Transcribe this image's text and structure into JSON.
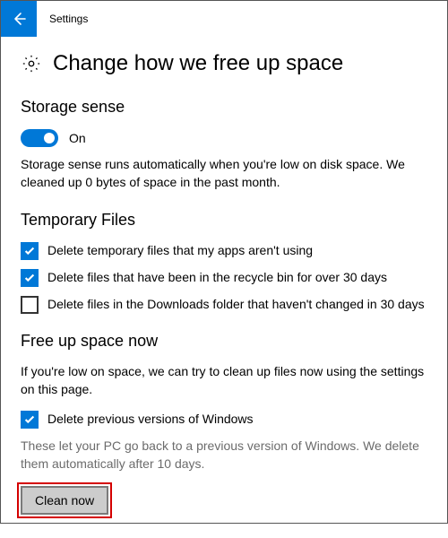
{
  "titlebar": {
    "app_name": "Settings"
  },
  "page": {
    "title": "Change how we free up space"
  },
  "storage_sense": {
    "heading": "Storage sense",
    "toggle_state_label": "On",
    "description": "Storage sense runs automatically when you're low on disk space. We cleaned up 0 bytes of space in the past month."
  },
  "temp_files": {
    "heading": "Temporary Files",
    "options": [
      {
        "label": "Delete temporary files that my apps aren't using",
        "checked": true
      },
      {
        "label": "Delete files that have been in the recycle bin for over 30 days",
        "checked": true
      },
      {
        "label": "Delete files in the Downloads folder that haven't changed in 30 days",
        "checked": false
      }
    ]
  },
  "free_up": {
    "heading": "Free up space now",
    "intro": "If you're low on space, we can try to clean up files now using the settings on this page.",
    "option_label": "Delete previous versions of Windows",
    "option_checked": true,
    "note": "These let your PC go back to a previous version of Windows. We delete them automatically after 10 days.",
    "button_label": "Clean now"
  }
}
